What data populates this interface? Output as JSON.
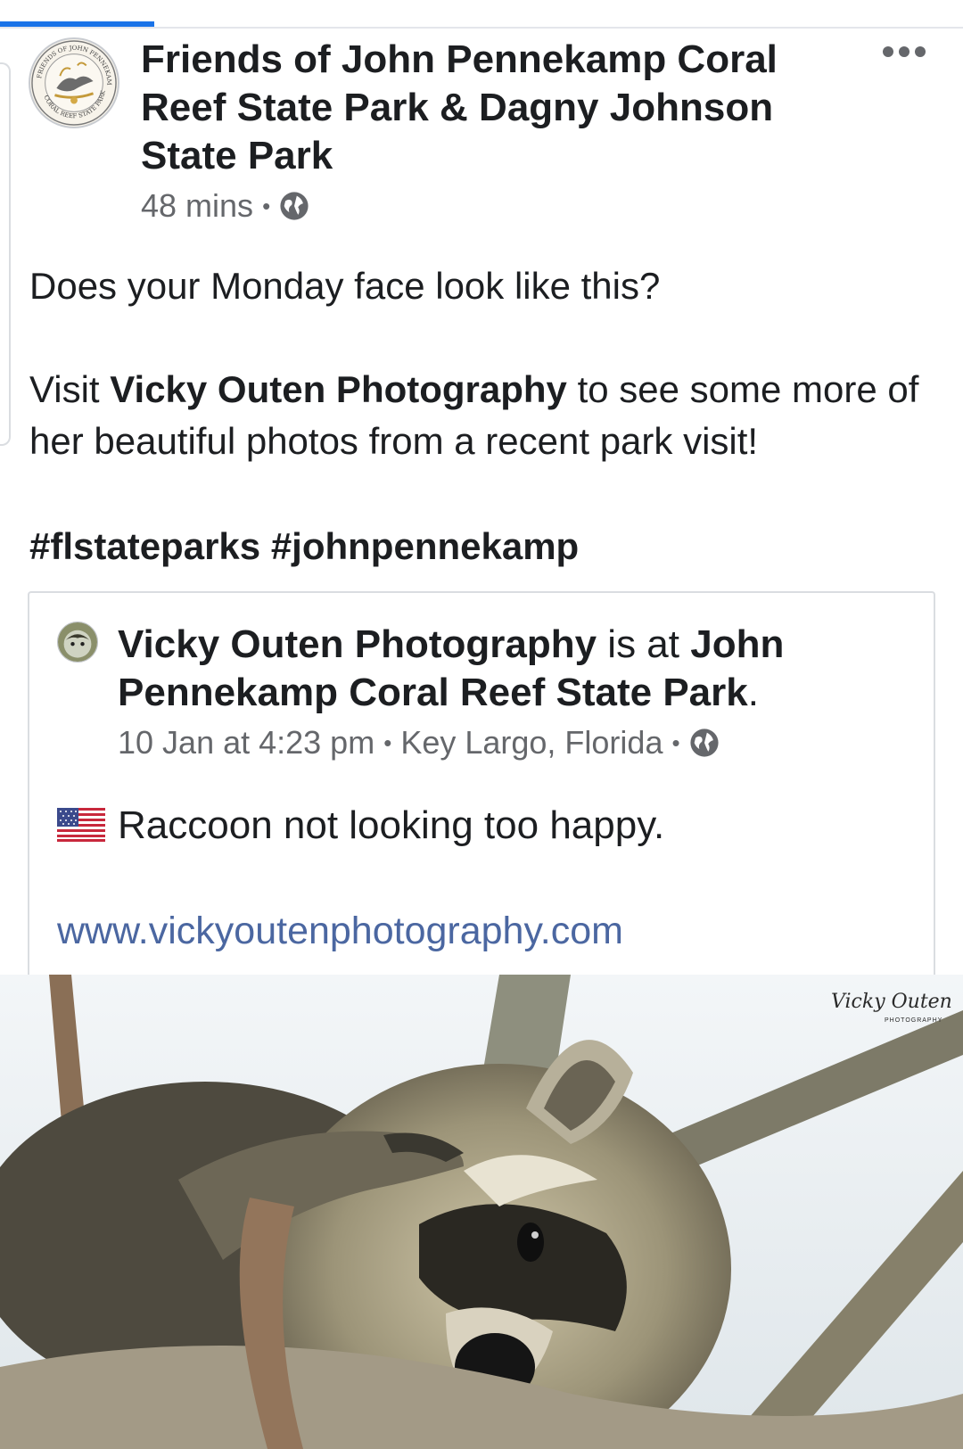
{
  "progress": {
    "fraction": 0.16
  },
  "post": {
    "page_name": "Friends of John Pennekamp Coral Reef State Park & Dagny Johnson State Park",
    "time": "48 mins",
    "separator": "•",
    "audience_icon": "globe-icon",
    "avatar_text_top": "FRIENDS OF JOHN PENNEKAMP",
    "avatar_text_bottom": "CORAL REEF STATE PARK",
    "line1": "Does your Monday face look like this?",
    "visit_prefix": "Visit ",
    "visit_link": "Vicky Outen Photography",
    "visit_suffix": " to see some more of her beautiful photos from a recent park visit!",
    "hashtag1": "#flstateparks",
    "hashtag2": "#johnpennekamp",
    "more_icon": "more-options-icon"
  },
  "shared": {
    "author": "Vicky Outen Photography",
    "is_at": " is at ",
    "place": "John Pennekamp Coral Reef State Park",
    "period": ".",
    "date": "10 Jan at 4:23 pm",
    "location": "Key Largo, Florida",
    "separator": "•",
    "flag_icon": "us-flag-icon",
    "text": "Raccoon not looking too happy.",
    "url": "www.vickyoutenphotography.com"
  },
  "photo": {
    "subject": "raccoon-photo",
    "watermark_name": "Vicky Outen",
    "watermark_sub": "PHOTOGRAPHY"
  },
  "colors": {
    "accent": "#1a73e8",
    "link": "#4b67a1",
    "text": "#1c1e21",
    "meta": "#65676b",
    "border": "#dadde1"
  }
}
